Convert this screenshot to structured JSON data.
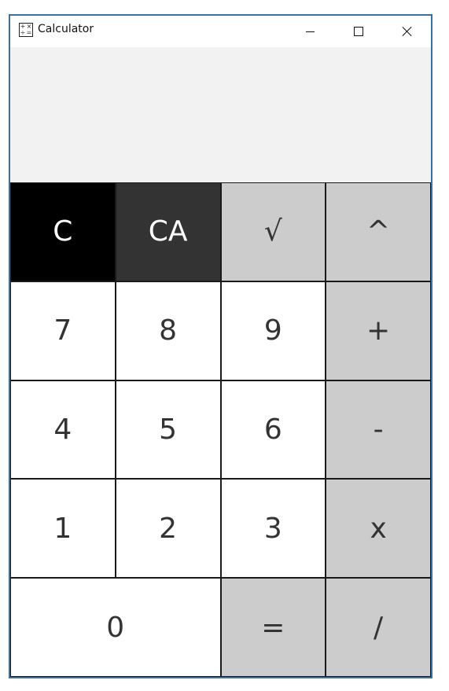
{
  "window": {
    "title": "Calculator",
    "app_icon_glyphs": [
      "+",
      "×",
      "÷",
      "="
    ],
    "controls": {
      "minimize": "minimize-icon",
      "maximize": "maximize-icon",
      "close": "close-icon"
    }
  },
  "display": {
    "value": ""
  },
  "colors": {
    "clear_key": "#000000",
    "clear_all_key": "#333333",
    "operator_key": "#cccccc",
    "digit_key": "#ffffff",
    "display_bg": "#f2f2f2"
  },
  "keypad": {
    "rows": [
      [
        {
          "label": "C",
          "style": "black"
        },
        {
          "label": "CA",
          "style": "dark"
        },
        {
          "label": "√",
          "style": "gray"
        },
        {
          "label": "^",
          "style": "gray"
        }
      ],
      [
        {
          "label": "7",
          "style": "white"
        },
        {
          "label": "8",
          "style": "white"
        },
        {
          "label": "9",
          "style": "white"
        },
        {
          "label": "+",
          "style": "gray"
        }
      ],
      [
        {
          "label": "4",
          "style": "white"
        },
        {
          "label": "5",
          "style": "white"
        },
        {
          "label": "6",
          "style": "white"
        },
        {
          "label": "-",
          "style": "gray"
        }
      ],
      [
        {
          "label": "1",
          "style": "white"
        },
        {
          "label": "2",
          "style": "white"
        },
        {
          "label": "3",
          "style": "white"
        },
        {
          "label": "x",
          "style": "gray"
        }
      ],
      [
        {
          "label": "0",
          "style": "white"
        },
        {
          "label": "=",
          "style": "gray"
        },
        {
          "label": "/",
          "style": "gray"
        }
      ]
    ]
  }
}
